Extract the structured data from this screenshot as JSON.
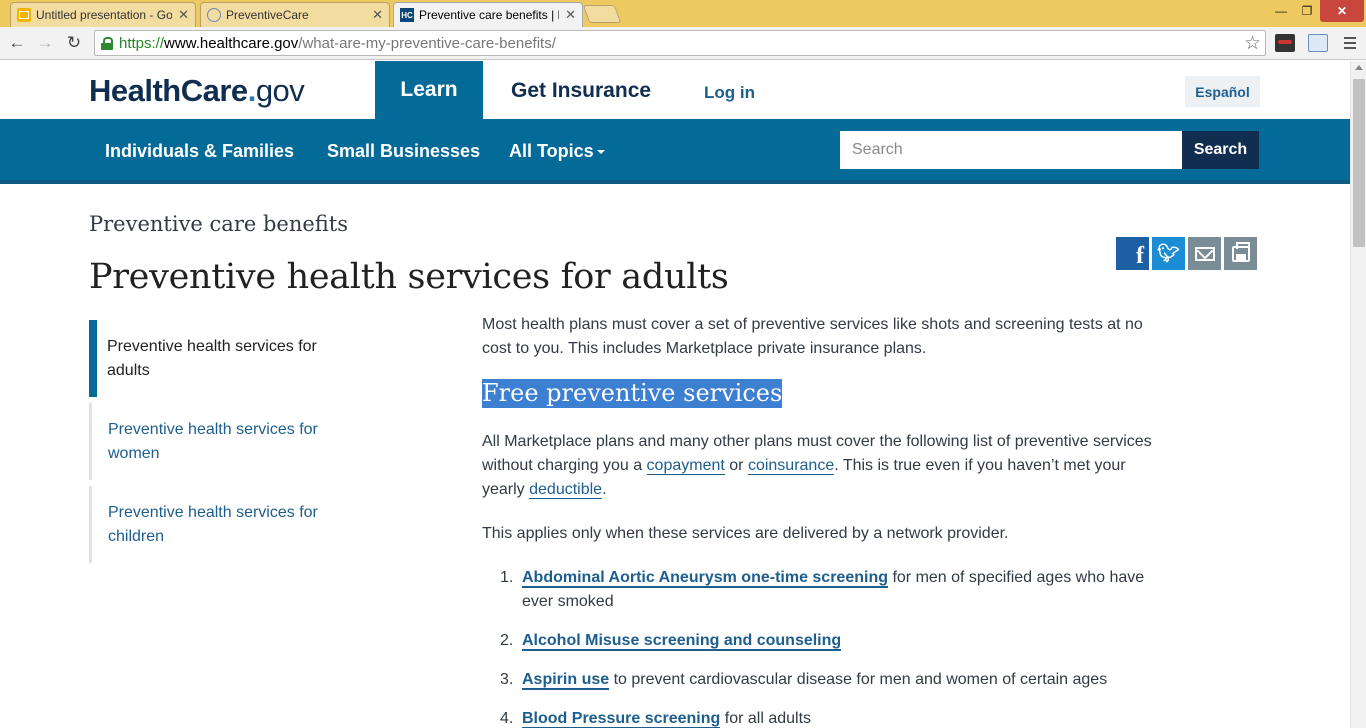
{
  "browser": {
    "tabs": [
      {
        "title": "Untitled presentation - Go",
        "favicon": "slides-icon"
      },
      {
        "title": "PreventiveCare",
        "favicon": "globe-icon"
      },
      {
        "title": "Preventive care benefits | H",
        "favicon": "HC"
      }
    ],
    "url": {
      "scheme": "https://",
      "host": "www.healthcare.gov",
      "path": "/what-are-my-preventive-care-benefits/"
    }
  },
  "site": {
    "logo": {
      "main": "HealthCare",
      "dot": ".",
      "tld": "gov"
    },
    "nav": {
      "learn": "Learn",
      "get_insurance": "Get Insurance",
      "login": "Log in",
      "espanol": "Español"
    },
    "subnav": {
      "individuals": "Individuals & Families",
      "small_businesses": "Small Businesses",
      "all_topics": "All Topics"
    },
    "search": {
      "placeholder": "Search",
      "button": "Search"
    },
    "colors": {
      "primary": "#046b99",
      "navy": "#112e51",
      "link": "#1d5e8e"
    }
  },
  "page": {
    "eyebrow": "Preventive care benefits",
    "title": "Preventive health services for adults",
    "share": [
      "facebook-icon",
      "twitter-icon",
      "email-icon",
      "print-icon"
    ]
  },
  "sidenav": {
    "items": [
      {
        "label": "Preventive health services for adults",
        "active": true
      },
      {
        "label": "Preventive health services for women",
        "active": false
      },
      {
        "label": "Preventive health services for children",
        "active": false
      }
    ]
  },
  "content": {
    "intro": "Most health plans must cover a set of preventive services like shots and screening tests at no cost to you. This includes Marketplace private insurance plans.",
    "heading": "Free preventive services",
    "para2": {
      "before": "All Marketplace plans and many other plans must cover the following list of preventive services without charging you a ",
      "copayment": "copayment",
      "or": " or ",
      "coinsurance": "coinsurance",
      "middle": ". This is true even if you haven’t met your yearly ",
      "deductible": "deductible",
      "end": "."
    },
    "para3": "This applies only when these services are delivered by a network provider.",
    "services": [
      {
        "num": "1.",
        "link": "Abdominal Aortic Aneurysm one-time screening",
        "rest": " for men of specified ages who have ever smoked"
      },
      {
        "num": "2.",
        "link": "Alcohol Misuse screening and counseling",
        "rest": ""
      },
      {
        "num": "3.",
        "link": "Aspirin use",
        "rest": " to prevent cardiovascular disease for men and women of certain ages"
      },
      {
        "num": "4.",
        "link": "Blood Pressure screening",
        "rest": " for all adults"
      }
    ]
  }
}
